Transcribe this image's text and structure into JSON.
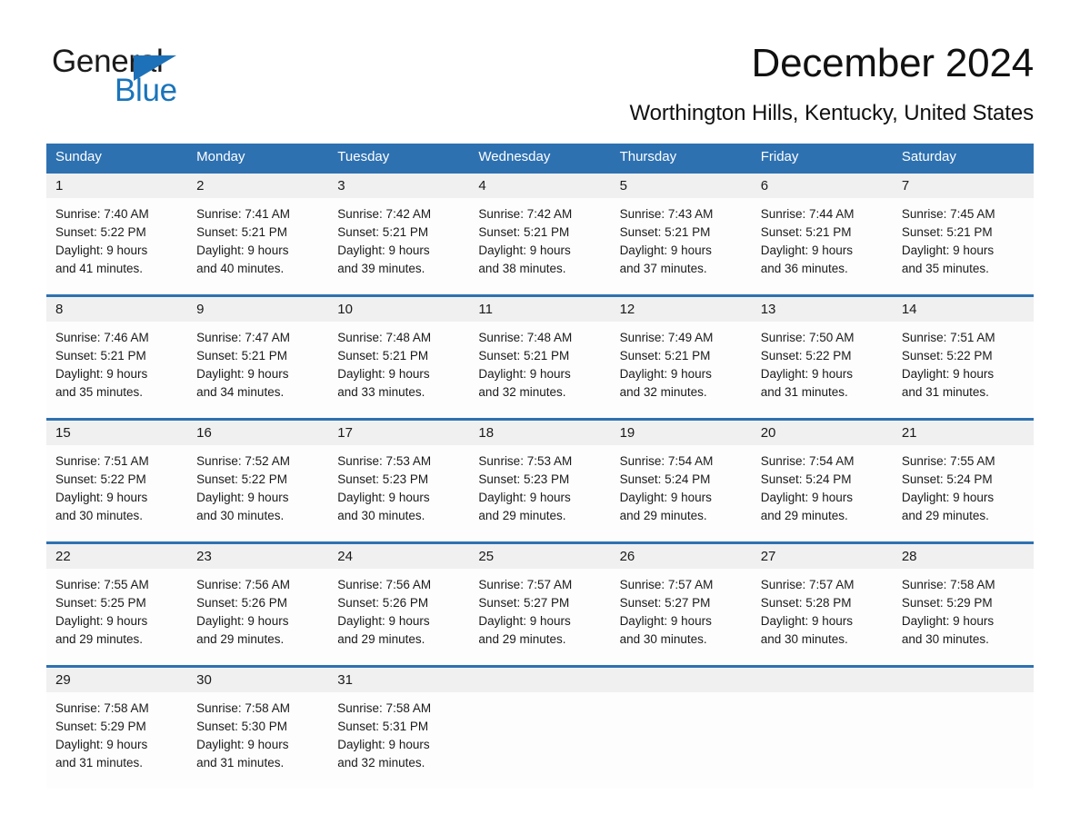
{
  "brand": {
    "name_part1": "General",
    "name_part2": "Blue",
    "triangle_color": "#1d71b8",
    "blue_text_color": "#1a74bb"
  },
  "header": {
    "title": "December 2024",
    "subtitle": "Worthington Hills, Kentucky, United States"
  },
  "theme": {
    "header_blue": "#2e71b1",
    "date_band_gray": "#f0f0f0",
    "cell_white": "#fdfdfd",
    "text_color": "#1a1a1a"
  },
  "calendar": {
    "weekdays": [
      "Sunday",
      "Monday",
      "Tuesday",
      "Wednesday",
      "Thursday",
      "Friday",
      "Saturday"
    ],
    "weeks": [
      {
        "days": [
          {
            "date": "1",
            "sunrise": "Sunrise: 7:40 AM",
            "sunset": "Sunset: 5:22 PM",
            "daylight_line1": "Daylight: 9 hours",
            "daylight_line2": "and 41 minutes."
          },
          {
            "date": "2",
            "sunrise": "Sunrise: 7:41 AM",
            "sunset": "Sunset: 5:21 PM",
            "daylight_line1": "Daylight: 9 hours",
            "daylight_line2": "and 40 minutes."
          },
          {
            "date": "3",
            "sunrise": "Sunrise: 7:42 AM",
            "sunset": "Sunset: 5:21 PM",
            "daylight_line1": "Daylight: 9 hours",
            "daylight_line2": "and 39 minutes."
          },
          {
            "date": "4",
            "sunrise": "Sunrise: 7:42 AM",
            "sunset": "Sunset: 5:21 PM",
            "daylight_line1": "Daylight: 9 hours",
            "daylight_line2": "and 38 minutes."
          },
          {
            "date": "5",
            "sunrise": "Sunrise: 7:43 AM",
            "sunset": "Sunset: 5:21 PM",
            "daylight_line1": "Daylight: 9 hours",
            "daylight_line2": "and 37 minutes."
          },
          {
            "date": "6",
            "sunrise": "Sunrise: 7:44 AM",
            "sunset": "Sunset: 5:21 PM",
            "daylight_line1": "Daylight: 9 hours",
            "daylight_line2": "and 36 minutes."
          },
          {
            "date": "7",
            "sunrise": "Sunrise: 7:45 AM",
            "sunset": "Sunset: 5:21 PM",
            "daylight_line1": "Daylight: 9 hours",
            "daylight_line2": "and 35 minutes."
          }
        ]
      },
      {
        "days": [
          {
            "date": "8",
            "sunrise": "Sunrise: 7:46 AM",
            "sunset": "Sunset: 5:21 PM",
            "daylight_line1": "Daylight: 9 hours",
            "daylight_line2": "and 35 minutes."
          },
          {
            "date": "9",
            "sunrise": "Sunrise: 7:47 AM",
            "sunset": "Sunset: 5:21 PM",
            "daylight_line1": "Daylight: 9 hours",
            "daylight_line2": "and 34 minutes."
          },
          {
            "date": "10",
            "sunrise": "Sunrise: 7:48 AM",
            "sunset": "Sunset: 5:21 PM",
            "daylight_line1": "Daylight: 9 hours",
            "daylight_line2": "and 33 minutes."
          },
          {
            "date": "11",
            "sunrise": "Sunrise: 7:48 AM",
            "sunset": "Sunset: 5:21 PM",
            "daylight_line1": "Daylight: 9 hours",
            "daylight_line2": "and 32 minutes."
          },
          {
            "date": "12",
            "sunrise": "Sunrise: 7:49 AM",
            "sunset": "Sunset: 5:21 PM",
            "daylight_line1": "Daylight: 9 hours",
            "daylight_line2": "and 32 minutes."
          },
          {
            "date": "13",
            "sunrise": "Sunrise: 7:50 AM",
            "sunset": "Sunset: 5:22 PM",
            "daylight_line1": "Daylight: 9 hours",
            "daylight_line2": "and 31 minutes."
          },
          {
            "date": "14",
            "sunrise": "Sunrise: 7:51 AM",
            "sunset": "Sunset: 5:22 PM",
            "daylight_line1": "Daylight: 9 hours",
            "daylight_line2": "and 31 minutes."
          }
        ]
      },
      {
        "days": [
          {
            "date": "15",
            "sunrise": "Sunrise: 7:51 AM",
            "sunset": "Sunset: 5:22 PM",
            "daylight_line1": "Daylight: 9 hours",
            "daylight_line2": "and 30 minutes."
          },
          {
            "date": "16",
            "sunrise": "Sunrise: 7:52 AM",
            "sunset": "Sunset: 5:22 PM",
            "daylight_line1": "Daylight: 9 hours",
            "daylight_line2": "and 30 minutes."
          },
          {
            "date": "17",
            "sunrise": "Sunrise: 7:53 AM",
            "sunset": "Sunset: 5:23 PM",
            "daylight_line1": "Daylight: 9 hours",
            "daylight_line2": "and 30 minutes."
          },
          {
            "date": "18",
            "sunrise": "Sunrise: 7:53 AM",
            "sunset": "Sunset: 5:23 PM",
            "daylight_line1": "Daylight: 9 hours",
            "daylight_line2": "and 29 minutes."
          },
          {
            "date": "19",
            "sunrise": "Sunrise: 7:54 AM",
            "sunset": "Sunset: 5:24 PM",
            "daylight_line1": "Daylight: 9 hours",
            "daylight_line2": "and 29 minutes."
          },
          {
            "date": "20",
            "sunrise": "Sunrise: 7:54 AM",
            "sunset": "Sunset: 5:24 PM",
            "daylight_line1": "Daylight: 9 hours",
            "daylight_line2": "and 29 minutes."
          },
          {
            "date": "21",
            "sunrise": "Sunrise: 7:55 AM",
            "sunset": "Sunset: 5:24 PM",
            "daylight_line1": "Daylight: 9 hours",
            "daylight_line2": "and 29 minutes."
          }
        ]
      },
      {
        "days": [
          {
            "date": "22",
            "sunrise": "Sunrise: 7:55 AM",
            "sunset": "Sunset: 5:25 PM",
            "daylight_line1": "Daylight: 9 hours",
            "daylight_line2": "and 29 minutes."
          },
          {
            "date": "23",
            "sunrise": "Sunrise: 7:56 AM",
            "sunset": "Sunset: 5:26 PM",
            "daylight_line1": "Daylight: 9 hours",
            "daylight_line2": "and 29 minutes."
          },
          {
            "date": "24",
            "sunrise": "Sunrise: 7:56 AM",
            "sunset": "Sunset: 5:26 PM",
            "daylight_line1": "Daylight: 9 hours",
            "daylight_line2": "and 29 minutes."
          },
          {
            "date": "25",
            "sunrise": "Sunrise: 7:57 AM",
            "sunset": "Sunset: 5:27 PM",
            "daylight_line1": "Daylight: 9 hours",
            "daylight_line2": "and 29 minutes."
          },
          {
            "date": "26",
            "sunrise": "Sunrise: 7:57 AM",
            "sunset": "Sunset: 5:27 PM",
            "daylight_line1": "Daylight: 9 hours",
            "daylight_line2": "and 30 minutes."
          },
          {
            "date": "27",
            "sunrise": "Sunrise: 7:57 AM",
            "sunset": "Sunset: 5:28 PM",
            "daylight_line1": "Daylight: 9 hours",
            "daylight_line2": "and 30 minutes."
          },
          {
            "date": "28",
            "sunrise": "Sunrise: 7:58 AM",
            "sunset": "Sunset: 5:29 PM",
            "daylight_line1": "Daylight: 9 hours",
            "daylight_line2": "and 30 minutes."
          }
        ]
      },
      {
        "days": [
          {
            "date": "29",
            "sunrise": "Sunrise: 7:58 AM",
            "sunset": "Sunset: 5:29 PM",
            "daylight_line1": "Daylight: 9 hours",
            "daylight_line2": "and 31 minutes."
          },
          {
            "date": "30",
            "sunrise": "Sunrise: 7:58 AM",
            "sunset": "Sunset: 5:30 PM",
            "daylight_line1": "Daylight: 9 hours",
            "daylight_line2": "and 31 minutes."
          },
          {
            "date": "31",
            "sunrise": "Sunrise: 7:58 AM",
            "sunset": "Sunset: 5:31 PM",
            "daylight_line1": "Daylight: 9 hours",
            "daylight_line2": "and 32 minutes."
          },
          {
            "date": "",
            "sunrise": "",
            "sunset": "",
            "daylight_line1": "",
            "daylight_line2": ""
          },
          {
            "date": "",
            "sunrise": "",
            "sunset": "",
            "daylight_line1": "",
            "daylight_line2": ""
          },
          {
            "date": "",
            "sunrise": "",
            "sunset": "",
            "daylight_line1": "",
            "daylight_line2": ""
          },
          {
            "date": "",
            "sunrise": "",
            "sunset": "",
            "daylight_line1": "",
            "daylight_line2": ""
          }
        ]
      }
    ]
  }
}
